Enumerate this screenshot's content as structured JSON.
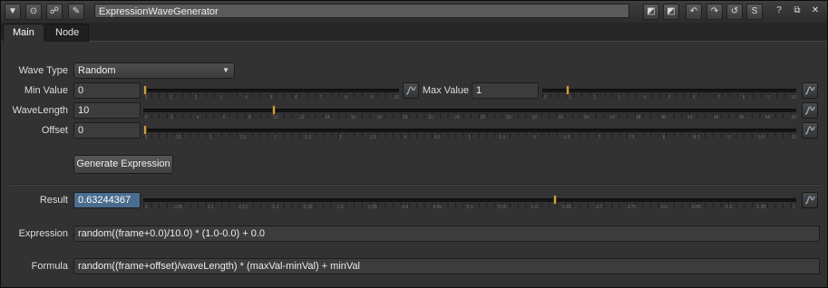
{
  "window": {
    "title": "ExpressionWaveGenerator",
    "buttons": [
      "?",
      "⧉",
      "✕"
    ]
  },
  "tabs": [
    {
      "label": "Main",
      "active": true
    },
    {
      "label": "Node",
      "active": false
    }
  ],
  "params": {
    "wave_type": {
      "label": "Wave Type",
      "value": "Random"
    },
    "min_value": {
      "label": "Min Value",
      "value": "0",
      "slider_level": 0.0
    },
    "max_value": {
      "label": "Max Value",
      "value": "1",
      "slider_level": 0.1
    },
    "wave_length": {
      "label": "WaveLength",
      "value": "10",
      "slider_level": 0.2
    },
    "offset": {
      "label": "Offset",
      "value": "0",
      "slider_level": 0.0
    }
  },
  "generate_label": "Generate Expression",
  "result": {
    "label": "Result",
    "value": "0.63244367",
    "slider_level": 0.63
  },
  "expression": {
    "label": "Expression",
    "value": "random((frame+0.0)/10.0) * (1.0-0.0) + 0.0"
  },
  "formula": {
    "label": "Formula",
    "value": "random((frame+offset)/waveLength) * (maxVal-minVal) + minVal"
  },
  "ticks": {
    "min_value": [
      "0",
      "1",
      "2",
      "3",
      "4",
      "5",
      "6",
      "7",
      "8",
      "9",
      "10"
    ],
    "max_value": [
      "0",
      "1",
      "2",
      "3",
      "4",
      "5",
      "6",
      "7",
      "8",
      "9",
      "10"
    ],
    "wave_length": [
      "0",
      "2",
      "4",
      "6",
      "8",
      "10",
      "12",
      "14",
      "16",
      "18",
      "20",
      "22",
      "24",
      "26",
      "28",
      "30",
      "32",
      "34",
      "36",
      "38",
      "40",
      "42",
      "44",
      "46",
      "48",
      "50"
    ],
    "offset": [
      "0",
      "0.5",
      "1",
      "1.5",
      "2",
      "2.5",
      "3",
      "3.5",
      "4",
      "4.5",
      "5",
      "5.5",
      "6",
      "6.5",
      "7",
      "7.5",
      "8",
      "8.5",
      "9",
      "9.5",
      "10"
    ],
    "result": [
      "0",
      "0.05",
      "0.1",
      "0.15",
      "0.2",
      "0.25",
      "0.3",
      "0.35",
      "0.4",
      "0.45",
      "0.5",
      "0.55",
      "0.6",
      "0.65",
      "0.7",
      "0.75",
      "0.8",
      "0.85",
      "0.9",
      "0.95",
      "1"
    ]
  },
  "colors": {
    "accent": "#c8a04a",
    "result_field": "#4a6d8f",
    "panel": "#323232"
  }
}
